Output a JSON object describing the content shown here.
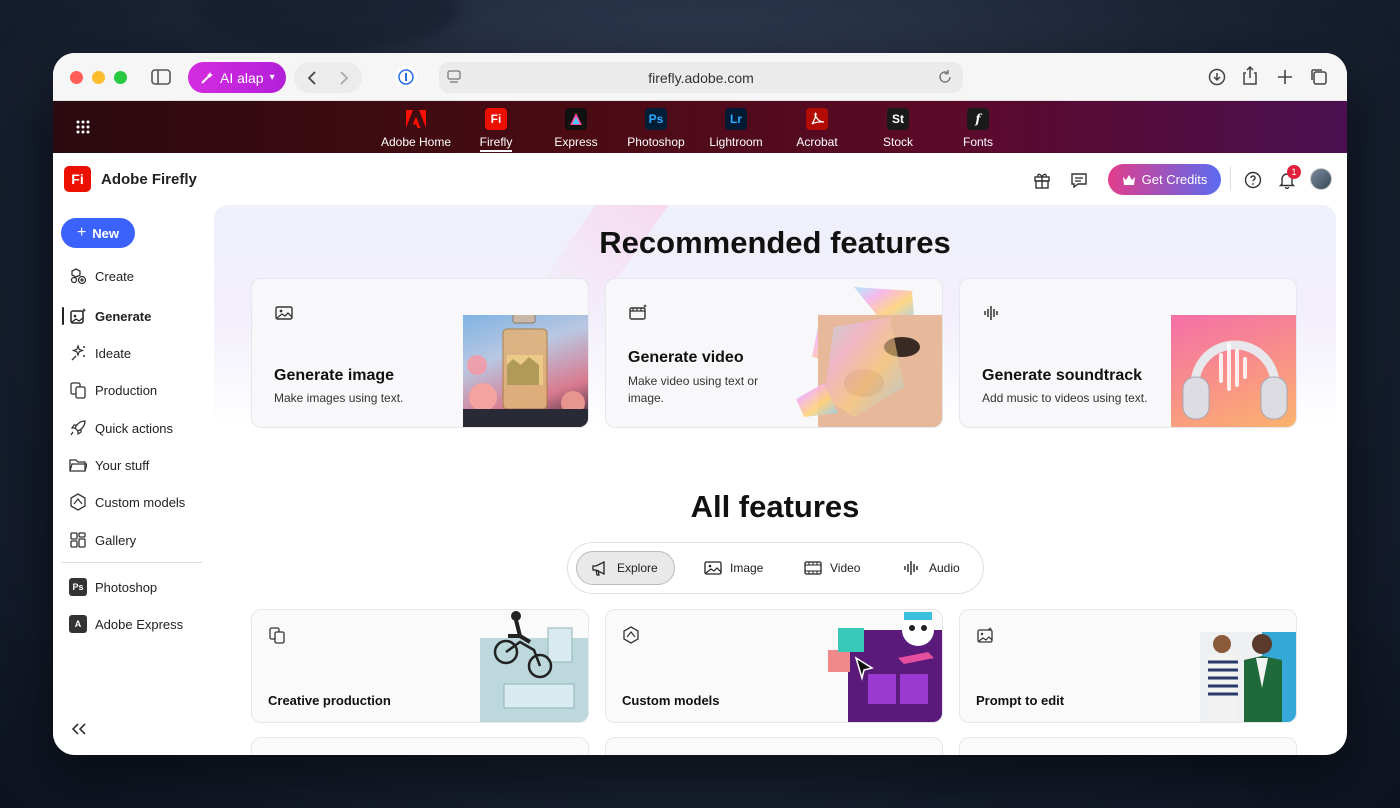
{
  "browser": {
    "ai_button_label": "AI alap",
    "url": "firefly.adobe.com"
  },
  "appbar": {
    "apps": [
      {
        "label": "Adobe Home",
        "abbr": "A",
        "color": "#eb1000"
      },
      {
        "label": "Firefly",
        "abbr": "Fi",
        "color": "#eb1000"
      },
      {
        "label": "Express",
        "abbr": "A",
        "color": "#1a1a2e"
      },
      {
        "label": "Photoshop",
        "abbr": "Ps",
        "color": "#001e36"
      },
      {
        "label": "Lightroom",
        "abbr": "Lr",
        "color": "#001a33"
      },
      {
        "label": "Acrobat",
        "abbr": "A",
        "color": "#b30b00"
      },
      {
        "label": "Stock",
        "abbr": "St",
        "color": "#222"
      },
      {
        "label": "Fonts",
        "abbr": "f",
        "color": "#222"
      }
    ]
  },
  "header": {
    "logo_abbr": "Fi",
    "title": "Adobe Firefly",
    "credits_label": "Get Credits",
    "notification_count": "1"
  },
  "sidebar": {
    "new_label": "New",
    "items": [
      {
        "label": "Create",
        "icon": "create-icon"
      },
      {
        "label": "Generate",
        "icon": "generate-icon"
      },
      {
        "label": "Ideate",
        "icon": "ideate-icon"
      },
      {
        "label": "Production",
        "icon": "production-icon"
      },
      {
        "label": "Quick actions",
        "icon": "rocket-icon"
      },
      {
        "label": "Your stuff",
        "icon": "folder-icon"
      },
      {
        "label": "Custom models",
        "icon": "custom-models-icon"
      },
      {
        "label": "Gallery",
        "icon": "gallery-icon"
      }
    ],
    "apps": [
      {
        "label": "Photoshop",
        "abbr": "Ps"
      },
      {
        "label": "Adobe Express",
        "abbr": "A"
      }
    ]
  },
  "main": {
    "recommended_title": "Recommended features",
    "recommended": [
      {
        "title": "Generate image",
        "desc": "Make images using text."
      },
      {
        "title": "Generate video",
        "desc": "Make video using text or image."
      },
      {
        "title": "Generate soundtrack",
        "desc": "Add music to videos using text."
      }
    ],
    "all_title": "All features",
    "tabs": [
      "Explore",
      "Image",
      "Video",
      "Audio"
    ],
    "features": [
      {
        "title": "Creative production"
      },
      {
        "title": "Custom models"
      },
      {
        "title": "Prompt to edit"
      }
    ]
  }
}
